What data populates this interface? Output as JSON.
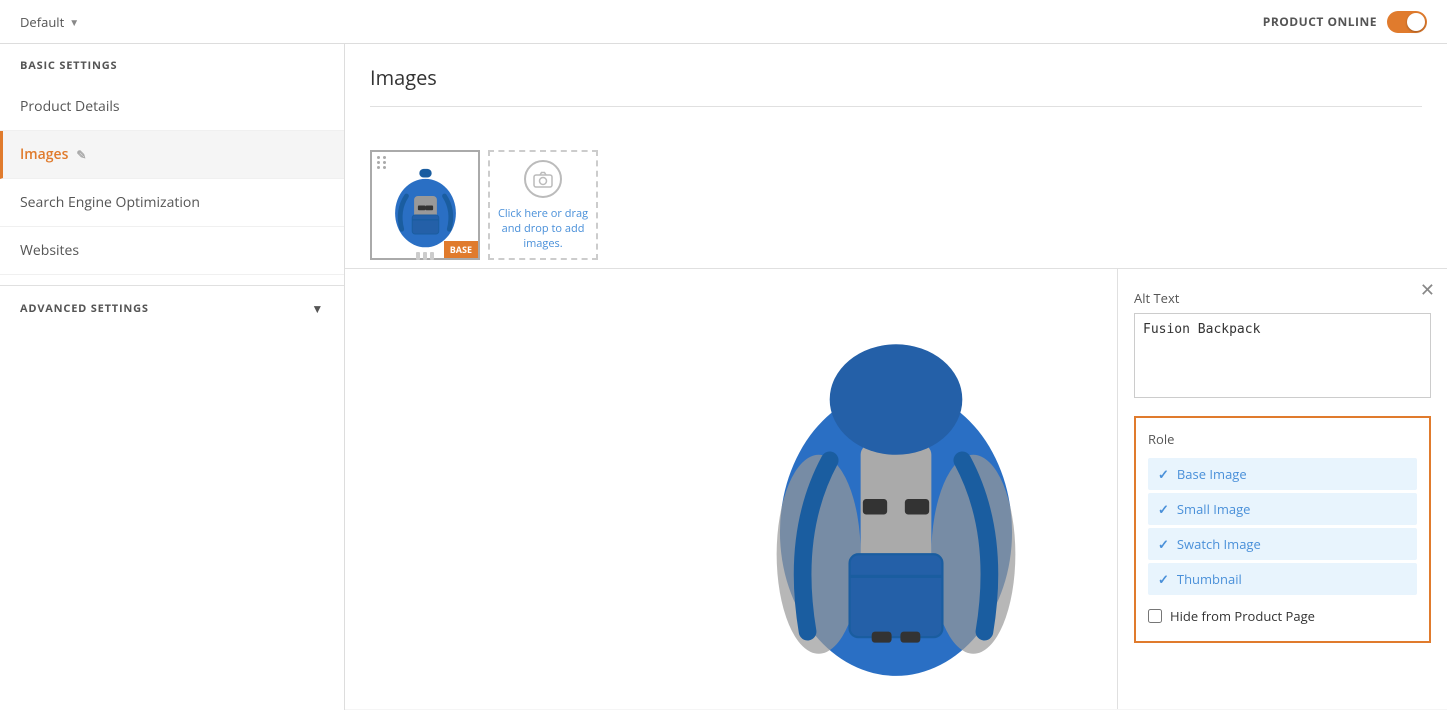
{
  "topbar": {
    "store_label": "Default",
    "product_online_label": "PRODUCT ONLINE"
  },
  "sidebar": {
    "basic_settings_label": "BASIC SETTINGS",
    "items": [
      {
        "id": "product-details",
        "label": "Product Details",
        "active": false
      },
      {
        "id": "images",
        "label": "Images",
        "active": true,
        "has_edit": true
      },
      {
        "id": "seo",
        "label": "Search Engine Optimization",
        "active": false
      },
      {
        "id": "websites",
        "label": "Websites",
        "active": false
      }
    ],
    "advanced_settings_label": "ADVANCED SETTINGS"
  },
  "content": {
    "images_title": "Images",
    "add_image_text": "Click here or drag and drop to add images.",
    "alt_text_label": "Alt Text",
    "alt_text_value": "Fusion Backpack",
    "role_label": "Role",
    "role_items": [
      {
        "label": "Base Image",
        "checked": true
      },
      {
        "label": "Small Image",
        "checked": true
      },
      {
        "label": "Swatch Image",
        "checked": true
      },
      {
        "label": "Thumbnail",
        "checked": true
      }
    ],
    "hide_label": "Hide from Product Page",
    "base_badge": "BASE"
  }
}
